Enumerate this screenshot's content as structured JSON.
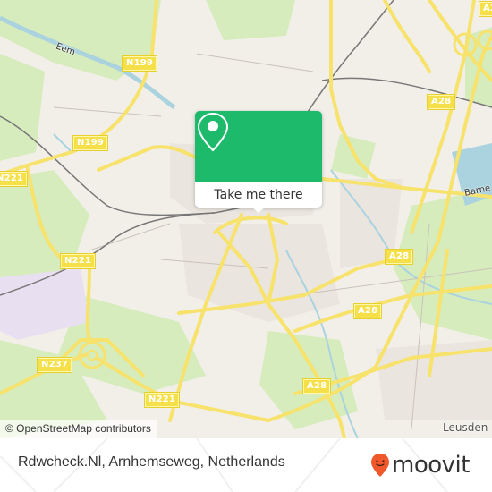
{
  "map": {
    "attribution": "© OpenStreetMap contributors",
    "road_labels": [
      {
        "id": "n199-top",
        "text": "N199"
      },
      {
        "id": "n199-left",
        "text": "N199"
      },
      {
        "id": "n221-left",
        "text": "N221"
      },
      {
        "id": "n221-mid",
        "text": "N221"
      },
      {
        "id": "n237",
        "text": "N237"
      },
      {
        "id": "n221-bottom",
        "text": "N221"
      },
      {
        "id": "a28-topright",
        "text": "A28"
      },
      {
        "id": "a28-upper",
        "text": "A28"
      },
      {
        "id": "a28-mid",
        "text": "A28"
      },
      {
        "id": "a28-lower",
        "text": "A28"
      },
      {
        "id": "a28-bottom",
        "text": "A28"
      },
      {
        "id": "a28-corner",
        "text": "A2"
      }
    ],
    "place_labels": {
      "eem": "Eem",
      "barne": "Barne",
      "leusden": "Leusden"
    },
    "colors": {
      "background": "#f2efe9",
      "green": "#cdebb0",
      "water": "#aad3df",
      "road": "#f7e26b",
      "marker": "#1dba6b"
    }
  },
  "popup": {
    "icon": "map-pin-icon",
    "button_label": "Take me there"
  },
  "footer": {
    "title": "Rdwcheck.Nl, Arnhemseweg, Netherlands",
    "brand": "moovit",
    "brand_color": "#f0572a"
  }
}
